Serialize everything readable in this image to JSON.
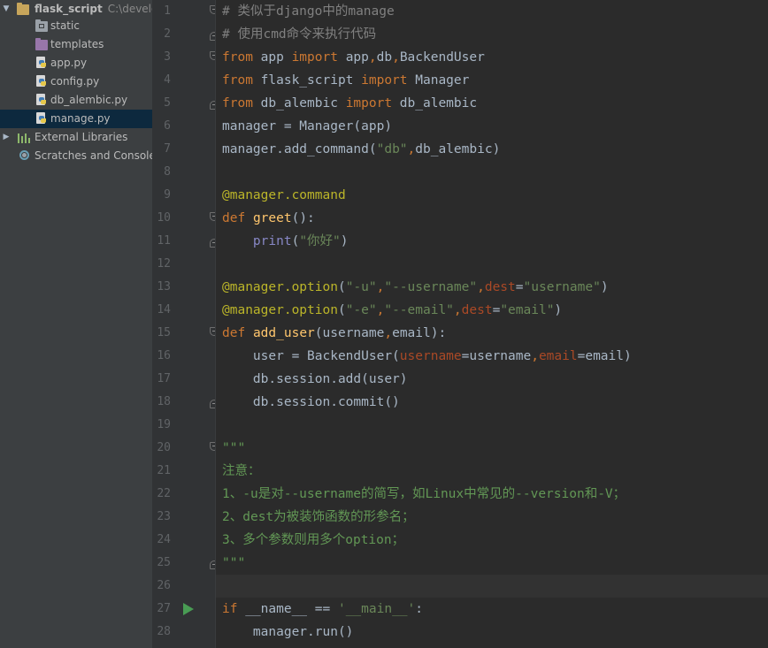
{
  "sidebar": {
    "root": {
      "label": "flask_script",
      "path": "C:\\develop"
    },
    "items": [
      {
        "label": "static",
        "icon": "folder-static-icon"
      },
      {
        "label": "templates",
        "icon": "folder-templates-icon"
      },
      {
        "label": "app.py",
        "icon": "python-file-icon"
      },
      {
        "label": "config.py",
        "icon": "python-file-icon"
      },
      {
        "label": "db_alembic.py",
        "icon": "python-file-icon"
      },
      {
        "label": "manage.py",
        "icon": "python-file-icon",
        "selected": true
      }
    ],
    "external_libraries": "External Libraries",
    "scratches": "Scratches and Consoles"
  },
  "editor": {
    "file": "manage.py",
    "current_line": 26,
    "run_line": 27,
    "lines": [
      {
        "n": "1",
        "fold": "start",
        "tokens": [
          [
            "comment",
            "# 类似于django中的manage"
          ]
        ]
      },
      {
        "n": "2",
        "fold": "end",
        "tokens": [
          [
            "comment",
            "# 使用cmd命令来执行代码"
          ]
        ]
      },
      {
        "n": "3",
        "fold": "start",
        "tokens": [
          [
            "kw",
            "from"
          ],
          [
            "plain",
            " app "
          ],
          [
            "kw",
            "import"
          ],
          [
            "plain",
            " app"
          ],
          [
            "kw",
            ","
          ],
          [
            "plain",
            "db"
          ],
          [
            "kw",
            ","
          ],
          [
            "plain",
            "BackendUser"
          ]
        ]
      },
      {
        "n": "4",
        "tokens": [
          [
            "kw",
            "from"
          ],
          [
            "plain",
            " flask_script "
          ],
          [
            "kw",
            "import"
          ],
          [
            "plain",
            " Manager"
          ]
        ]
      },
      {
        "n": "5",
        "fold": "end",
        "tokens": [
          [
            "kw",
            "from"
          ],
          [
            "plain",
            " db_alembic "
          ],
          [
            "kw",
            "import"
          ],
          [
            "plain",
            " db_alembic"
          ]
        ]
      },
      {
        "n": "6",
        "tokens": [
          [
            "plain",
            "manager = Manager(app)"
          ]
        ]
      },
      {
        "n": "7",
        "tokens": [
          [
            "plain",
            "manager.add_command("
          ],
          [
            "str",
            "\"db\""
          ],
          [
            "kw",
            ","
          ],
          [
            "plain",
            "db_alembic)"
          ]
        ]
      },
      {
        "n": "8",
        "tokens": []
      },
      {
        "n": "9",
        "tokens": [
          [
            "deco",
            "@manager.command"
          ]
        ]
      },
      {
        "n": "10",
        "fold": "start",
        "tokens": [
          [
            "kw",
            "def"
          ],
          [
            "plain",
            " "
          ],
          [
            "fn",
            "greet"
          ],
          [
            "plain",
            "():"
          ]
        ]
      },
      {
        "n": "11",
        "fold": "end",
        "tokens": [
          [
            "plain",
            "    "
          ],
          [
            "builtin",
            "print"
          ],
          [
            "plain",
            "("
          ],
          [
            "str",
            "\"你好\""
          ],
          [
            "plain",
            ")"
          ]
        ]
      },
      {
        "n": "12",
        "tokens": []
      },
      {
        "n": "13",
        "tokens": [
          [
            "deco",
            "@manager.option"
          ],
          [
            "plain",
            "("
          ],
          [
            "str",
            "\"-u\""
          ],
          [
            "kw",
            ","
          ],
          [
            "str",
            "\"--username\""
          ],
          [
            "kw",
            ","
          ],
          [
            "param",
            "dest"
          ],
          [
            "plain",
            "="
          ],
          [
            "str",
            "\"username\""
          ],
          [
            "plain",
            ")"
          ]
        ]
      },
      {
        "n": "14",
        "tokens": [
          [
            "deco",
            "@manager.option"
          ],
          [
            "plain",
            "("
          ],
          [
            "str",
            "\"-e\""
          ],
          [
            "kw",
            ","
          ],
          [
            "str",
            "\"--email\""
          ],
          [
            "kw",
            ","
          ],
          [
            "param",
            "dest"
          ],
          [
            "plain",
            "="
          ],
          [
            "str",
            "\"email\""
          ],
          [
            "plain",
            ")"
          ]
        ]
      },
      {
        "n": "15",
        "fold": "start",
        "tokens": [
          [
            "kw",
            "def"
          ],
          [
            "plain",
            " "
          ],
          [
            "fn",
            "add_user"
          ],
          [
            "plain",
            "(username"
          ],
          [
            "kw",
            ","
          ],
          [
            "plain",
            "email):"
          ]
        ]
      },
      {
        "n": "16",
        "tokens": [
          [
            "plain",
            "    user = BackendUser("
          ],
          [
            "param",
            "username"
          ],
          [
            "plain",
            "=username"
          ],
          [
            "kw",
            ","
          ],
          [
            "param",
            "email"
          ],
          [
            "plain",
            "=email)"
          ]
        ]
      },
      {
        "n": "17",
        "tokens": [
          [
            "plain",
            "    db.session.add(user)"
          ]
        ]
      },
      {
        "n": "18",
        "fold": "end",
        "tokens": [
          [
            "plain",
            "    db.session.commit()"
          ]
        ]
      },
      {
        "n": "19",
        "tokens": []
      },
      {
        "n": "20",
        "fold": "start",
        "tokens": [
          [
            "doc",
            "\"\"\""
          ]
        ]
      },
      {
        "n": "21",
        "tokens": [
          [
            "doc",
            "注意："
          ]
        ]
      },
      {
        "n": "22",
        "tokens": [
          [
            "doc",
            "1、-u是对--username的简写，如Linux中常见的--version和-V；"
          ]
        ]
      },
      {
        "n": "23",
        "tokens": [
          [
            "doc",
            "2、dest为被装饰函数的形参名；"
          ]
        ]
      },
      {
        "n": "24",
        "tokens": [
          [
            "doc",
            "3、多个参数则用多个option；"
          ]
        ]
      },
      {
        "n": "25",
        "fold": "end",
        "tokens": [
          [
            "doc",
            "\"\"\""
          ]
        ]
      },
      {
        "n": "26",
        "tokens": []
      },
      {
        "n": "27",
        "tokens": [
          [
            "kw",
            "if"
          ],
          [
            "plain",
            " __name__ == "
          ],
          [
            "str",
            "'__main__'"
          ],
          [
            "plain",
            ":"
          ]
        ]
      },
      {
        "n": "28",
        "tokens": [
          [
            "plain",
            "    manager.run()"
          ]
        ]
      }
    ]
  },
  "colors": {
    "sidebar_bg": "#3c3f41",
    "editor_bg": "#2b2b2b",
    "gutter_bg": "#313335",
    "selection": "#0d293e",
    "keyword": "#cc7832",
    "string": "#6a8759",
    "comment": "#808080",
    "decorator": "#bbb529",
    "function": "#ffc66d",
    "docstring": "#629755",
    "run_icon": "#499c54"
  }
}
